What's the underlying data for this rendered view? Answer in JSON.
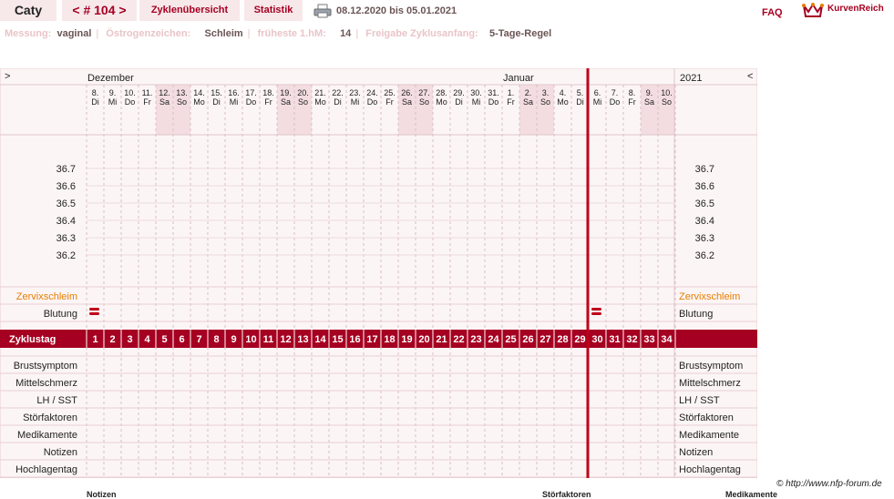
{
  "topbar": {
    "user": "Caty",
    "cycle_nav": "< # 104 >",
    "overview_tab": "Zyklenübersicht",
    "stats_tab": "Statistik",
    "date_range": "08.12.2020 bis 05.01.2021",
    "faq": "FAQ",
    "brand": "KurvenReich"
  },
  "info": [
    {
      "label": "Messung:",
      "value": "vaginal"
    },
    {
      "label": "Östrogenzeichen:",
      "value": "Schleim"
    },
    {
      "label": "früheste 1.hM:",
      "value": "14"
    },
    {
      "label": "Freigabe Zyklusanfang:",
      "value": "5-Tage-Regel"
    }
  ],
  "chart": {
    "nav_left": ">",
    "nav_right": "<",
    "year": "2021",
    "months": [
      {
        "name": "Dezember",
        "col": 0
      },
      {
        "name": "Januar",
        "col": 24
      }
    ],
    "days": [
      {
        "d": "8.",
        "w": "Di"
      },
      {
        "d": "9.",
        "w": "Mi"
      },
      {
        "d": "10.",
        "w": "Do"
      },
      {
        "d": "11.",
        "w": "Fr"
      },
      {
        "d": "12.",
        "w": "Sa"
      },
      {
        "d": "13.",
        "w": "So"
      },
      {
        "d": "14.",
        "w": "Mo"
      },
      {
        "d": "15.",
        "w": "Di"
      },
      {
        "d": "16.",
        "w": "Mi"
      },
      {
        "d": "17.",
        "w": "Do"
      },
      {
        "d": "18.",
        "w": "Fr"
      },
      {
        "d": "19.",
        "w": "Sa"
      },
      {
        "d": "20.",
        "w": "So"
      },
      {
        "d": "21.",
        "w": "Mo"
      },
      {
        "d": "22.",
        "w": "Di"
      },
      {
        "d": "23.",
        "w": "Mi"
      },
      {
        "d": "24.",
        "w": "Do"
      },
      {
        "d": "25.",
        "w": "Fr"
      },
      {
        "d": "26.",
        "w": "Sa"
      },
      {
        "d": "27.",
        "w": "So"
      },
      {
        "d": "28.",
        "w": "Mo"
      },
      {
        "d": "29.",
        "w": "Di"
      },
      {
        "d": "30.",
        "w": "Mi"
      },
      {
        "d": "31.",
        "w": "Do"
      },
      {
        "d": "1.",
        "w": "Fr"
      },
      {
        "d": "2.",
        "w": "Sa"
      },
      {
        "d": "3.",
        "w": "So"
      },
      {
        "d": "4.",
        "w": "Mo"
      },
      {
        "d": "5.",
        "w": "Di"
      },
      {
        "d": "6.",
        "w": "Mi"
      },
      {
        "d": "7.",
        "w": "Do"
      },
      {
        "d": "8.",
        "w": "Fr"
      },
      {
        "d": "9.",
        "w": "Sa"
      },
      {
        "d": "10.",
        "w": "So"
      }
    ],
    "weekend_days": [
      4,
      5,
      11,
      12,
      18,
      19,
      25,
      26,
      32,
      33
    ],
    "temperatures": [
      "36.7",
      "36.6",
      "36.5",
      "36.4",
      "36.3",
      "36.2"
    ],
    "mucus_label": "Zervixschleim",
    "bleeding_label": "Blutung",
    "bleeding_days": [
      1,
      30
    ],
    "cycle_label": "Zyklustag",
    "cycle_days": [
      "1",
      "2",
      "3",
      "4",
      "5",
      "6",
      "7",
      "8",
      "9",
      "10",
      "11",
      "12",
      "13",
      "14",
      "15",
      "16",
      "17",
      "18",
      "19",
      "20",
      "21",
      "22",
      "23",
      "24",
      "25",
      "26",
      "27",
      "28",
      "29",
      "30",
      "31",
      "32",
      "33",
      "34"
    ],
    "dashed_marker_day": 29,
    "cycle_start_day": 30,
    "symptoms": [
      "Brustsymptom",
      "Mittelschmerz",
      "LH / SST",
      "Störfaktoren",
      "Medikamente",
      "Notizen",
      "Hochlagentag"
    ]
  },
  "footer": {
    "copyright": "© http://www.nfp-forum.de",
    "bottom_headers": [
      "Notizen",
      "Störfaktoren",
      "Medikamente"
    ]
  },
  "colors": {
    "accent": "#a50021",
    "pink_bg": "#f7e8ea",
    "chart_bg": "#fcf5f6",
    "mucus": "#e67e00"
  }
}
